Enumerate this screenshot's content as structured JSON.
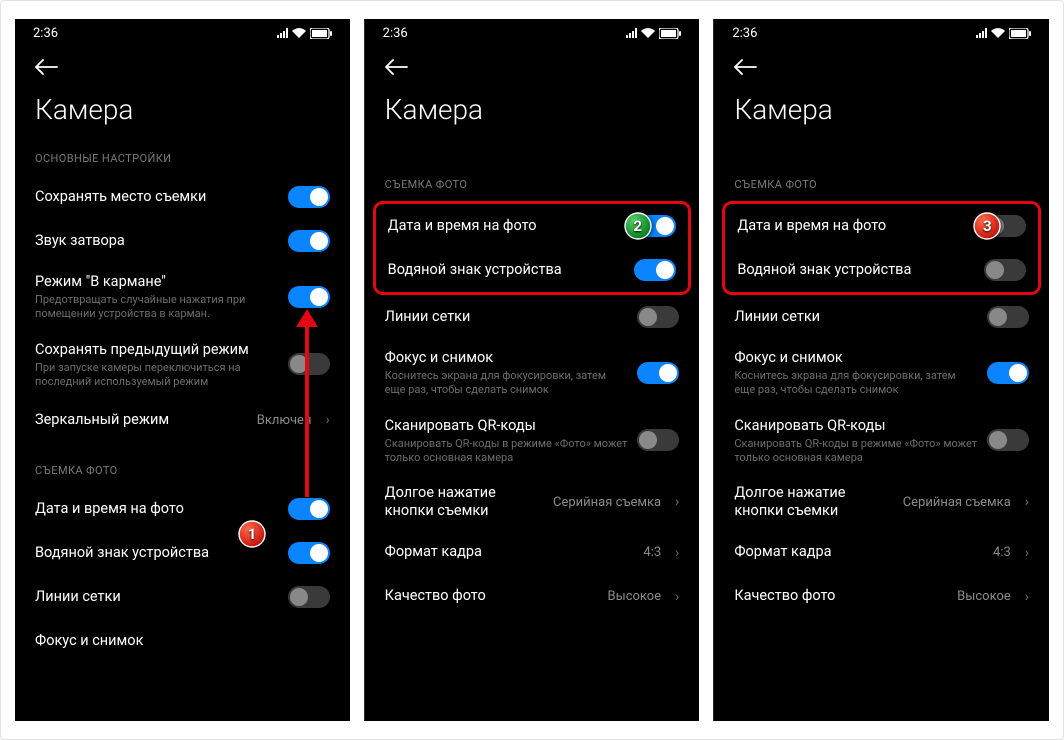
{
  "statusbar": {
    "time": "2:36"
  },
  "title": "Камера",
  "sections": {
    "main": "ОСНОВНЫЕ НАСТРОЙКИ",
    "photo": "СЪЕМКА ФОТО"
  },
  "labels": {
    "save_location": "Сохранять место съемки",
    "shutter_sound": "Звук затвора",
    "pocket_mode": "Режим \"В кармане\"",
    "pocket_mode_sub": "Предотвращать случайные нажатия при помещении устройства в карман.",
    "save_prev_mode": "Сохранять предыдущий режим",
    "save_prev_mode_sub": "При запуске камеры переключиться на последний используемый режим",
    "mirror_mode": "Зеркальный режим",
    "datetime_photo": "Дата и время на фото",
    "watermark": "Водяной знак устройства",
    "grid_lines": "Линии сетки",
    "focus_shoot": "Фокус и снимок",
    "focus_shoot_sub": "Коснитесь экрана для фокусировки, затем еще раз, чтобы сделать снимок",
    "scan_qr": "Сканировать QR-коды",
    "scan_qr_sub": "Сканировать QR-коды в режиме «Фото» может только основная камера",
    "long_press": "Долгое нажатие кнопки съемки",
    "frame_format": "Формат кадра",
    "photo_quality": "Качество фото"
  },
  "values": {
    "mirror_mode": "Включен",
    "long_press": "Серийная съемка",
    "frame_format": "4:3",
    "photo_quality": "Высокое"
  },
  "badges": {
    "b1": "1",
    "b2": "2",
    "b3": "3"
  }
}
